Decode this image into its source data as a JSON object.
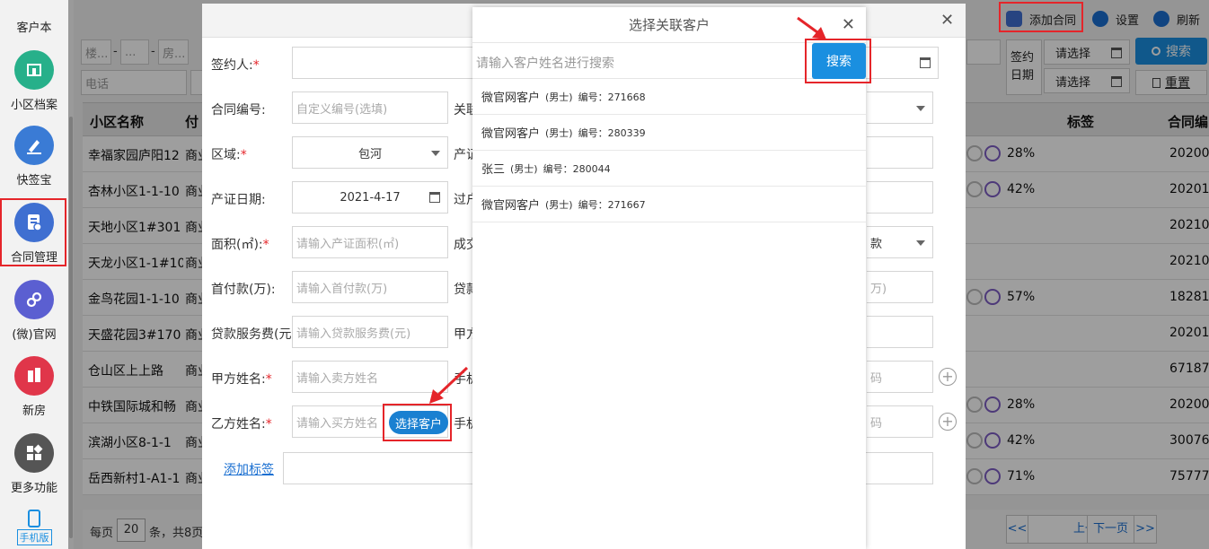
{
  "sidebar": {
    "items": [
      {
        "label": "客户本",
        "icon": "address-book-icon",
        "color": "#3d8ee6"
      },
      {
        "label": "小区档案",
        "icon": "building-icon",
        "color": "#27b08a"
      },
      {
        "label": "快签宝",
        "icon": "pen-icon",
        "color": "#3a7bd5"
      },
      {
        "label": "合同管理",
        "icon": "contract-icon",
        "color": "#3f6fd1"
      },
      {
        "label": "(微)官网",
        "icon": "link-icon",
        "color": "#5b5fd1"
      },
      {
        "label": "新房",
        "icon": "house-icon",
        "color": "#e0364a"
      },
      {
        "label": "更多功能",
        "icon": "grid-icon",
        "color": "#555555"
      },
      {
        "label": "手机版",
        "icon": "phone-icon",
        "color": "#1a8fe0"
      }
    ]
  },
  "toolbar": {
    "add_contract": "添加合同",
    "settings": "设置",
    "refresh": "刷新"
  },
  "filters": {
    "building_ph": "楼...",
    "unit_ph": "...",
    "room_ph": "房...",
    "dash": "-",
    "phone_ph": "电话",
    "sign_date_label": "签约日期",
    "select_ph": "请选择",
    "search_btn": "搜索",
    "reset_btn": "重置"
  },
  "table": {
    "headers": [
      "小区名称",
      "付",
      "标签",
      "合同编"
    ],
    "rows": [
      {
        "name": "幸福家园庐阳12",
        "type": "商业",
        "pct": "28%",
        "code": "20200..."
      },
      {
        "name": "杏林小区1-1-10",
        "type": "商业",
        "pct": "42%",
        "code": "20201..."
      },
      {
        "name": "天地小区1#301",
        "type": "商业",
        "pct": "",
        "code": "20210..."
      },
      {
        "name": "天龙小区1-1#10",
        "type": "商业",
        "pct": "",
        "code": "20210..."
      },
      {
        "name": "金鸟花园1-1-10",
        "type": "商业",
        "pct": "57%",
        "code": "18281..."
      },
      {
        "name": "天盛花园3#170",
        "type": "商业",
        "pct": "",
        "code": "20201..."
      },
      {
        "name": "仓山区上上路",
        "type": "商业",
        "pct": "",
        "code": "67187..."
      },
      {
        "name": "中铁国际城和畅",
        "type": "商业",
        "pct": "28%",
        "code": "20200..."
      },
      {
        "name": "滨湖小区8-1-1",
        "type": "商业",
        "pct": "42%",
        "code": "30076..."
      },
      {
        "name": "岳西新村1-A1-1",
        "type": "商业",
        "pct": "71%",
        "code": "75777..."
      }
    ]
  },
  "pager": {
    "per_page": "每页",
    "per_page_value": "20",
    "suffix": "条，共8页",
    "first": "<<",
    "prev": "上一页",
    "next": "下一页",
    "last": ">>"
  },
  "contract_form": {
    "signer_label": "签约人:",
    "contract_no_label": "合同编号:",
    "contract_no_ph": "自定义编号(选填)",
    "related_label": "关联",
    "region_label": "区域:",
    "region_value": "包河",
    "cert_label": "产证",
    "cert_date_label": "产证日期:",
    "cert_date_value": "2021-4-17",
    "transfer_label": "过户",
    "area_label": "面积(㎡):",
    "area_ph": "请输入产证面积(㎡)",
    "deal_label": "成交",
    "deal_tail": "款",
    "down_label": "首付款(万):",
    "down_ph": "请输入首付款(万)",
    "loan_label": "贷款",
    "loan_tail": "万)",
    "loan_fee_label": "贷款服务费(元):",
    "loan_fee_ph": "请输入贷款服务费(元)",
    "party_a_label_short": "甲方",
    "party_a_name_label": "甲方姓名:",
    "party_a_name_ph": "请输入卖方姓名",
    "phone_label": "手机",
    "phone_tail": "码",
    "party_b_name_label": "乙方姓名:",
    "party_b_name_ph": "请输入买方姓名",
    "select_customer_btn": "选择客户",
    "add_tag_link": "添加标签"
  },
  "customer_modal": {
    "title": "选择关联客户",
    "search_ph": "请输入客户姓名进行搜索",
    "search_btn": "搜索",
    "customers": [
      {
        "name": "微官网客户",
        "gender": "(男士)",
        "id_text": "编号：271668"
      },
      {
        "name": "微官网客户",
        "gender": "(男士)",
        "id_text": "编号：280339"
      },
      {
        "name": "张三",
        "gender": "(男士)",
        "id_text": "编号：280044"
      },
      {
        "name": "微官网客户",
        "gender": "(男士)",
        "id_text": "编号：271667"
      }
    ]
  },
  "colors": {
    "accent": "#1a8fe0",
    "highlight": "#e5252a"
  }
}
